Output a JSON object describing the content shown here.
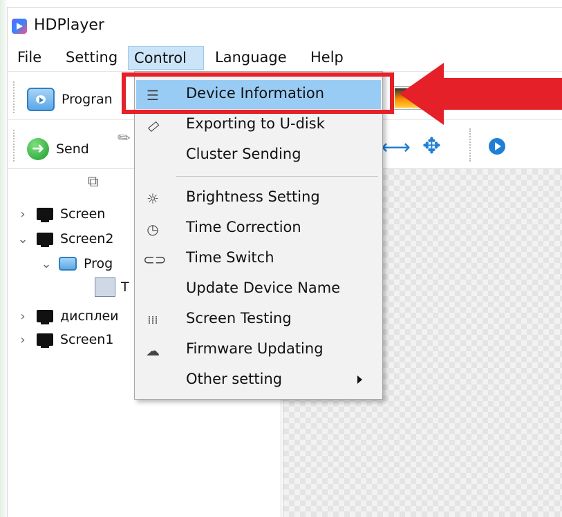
{
  "window": {
    "title": "HDPlayer"
  },
  "menubar": {
    "items": [
      {
        "label": "File"
      },
      {
        "label": "Setting"
      },
      {
        "label": "Control"
      },
      {
        "label": "Language"
      },
      {
        "label": "Help"
      }
    ]
  },
  "toolbar": {
    "program_label": "Progran",
    "send_label": "Send"
  },
  "tree": {
    "items": [
      {
        "label": "Screen",
        "expanded": false
      },
      {
        "label": "Screen2",
        "expanded": true
      },
      {
        "label": "Prog",
        "expanded": true
      },
      {
        "label": "T"
      },
      {
        "label": "дисплеи",
        "expanded": false
      },
      {
        "label": "Screen1",
        "expanded": false
      }
    ]
  },
  "control_menu": {
    "items": [
      {
        "label": "Device Information",
        "icon": "list-icon",
        "highlighted": true
      },
      {
        "label": "Exporting to U-disk",
        "icon": "usb-icon"
      },
      {
        "label": "Cluster Sending",
        "icon": ""
      },
      {
        "label": "Brightness Setting",
        "icon": "bulb-icon"
      },
      {
        "label": "Time Correction",
        "icon": "clock-icon"
      },
      {
        "label": "Time Switch",
        "icon": "toggle-icon"
      },
      {
        "label": "Update Device Name",
        "icon": ""
      },
      {
        "label": "Screen Testing",
        "icon": "dots-grid-icon"
      },
      {
        "label": "Firmware Updating",
        "icon": "cloud-icon"
      },
      {
        "label": "Other setting",
        "icon": "",
        "has_submenu": true
      }
    ]
  },
  "colors": {
    "highlight": "#99ccf5",
    "annotation_red": "#e52029",
    "accent_blue": "#1e7fd6"
  }
}
